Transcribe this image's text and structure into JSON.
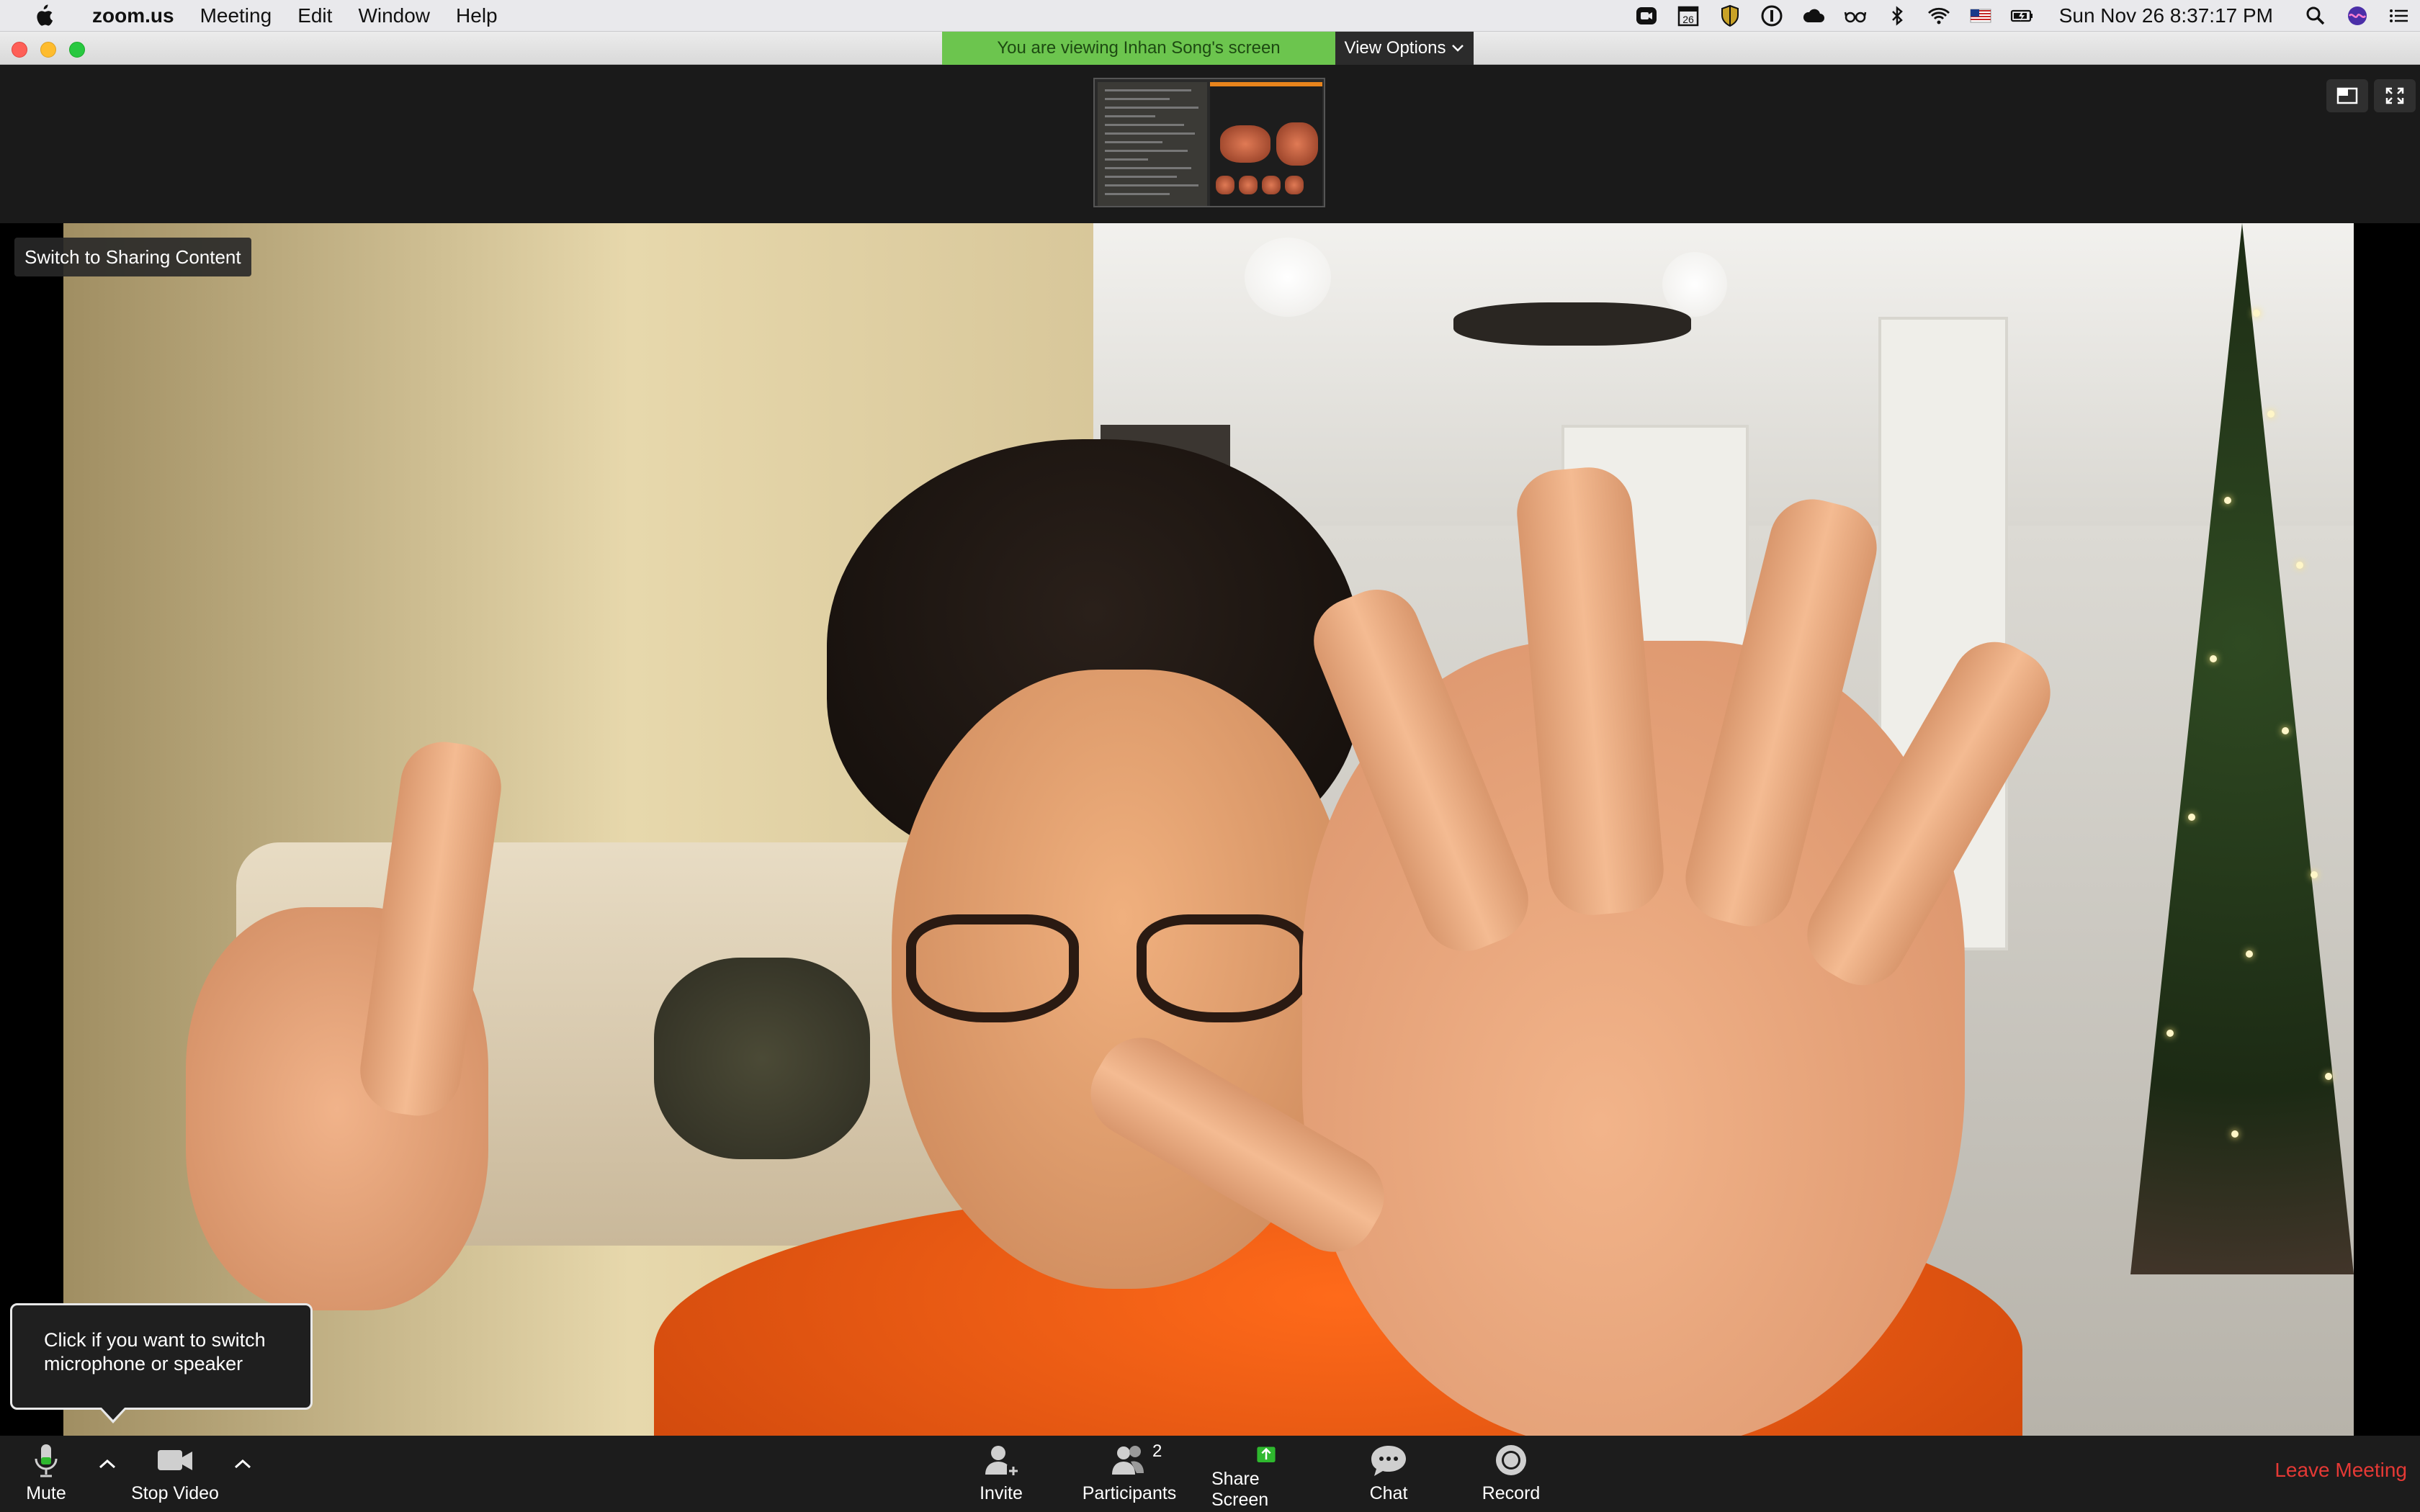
{
  "menubar": {
    "app_name": "zoom.us",
    "menus": [
      "Meeting",
      "Edit",
      "Window",
      "Help"
    ],
    "calendar_day": "26",
    "clock": "Sun Nov 26  8:37:17 PM"
  },
  "window": {
    "share_banner": "You are viewing Inhan Song's screen",
    "view_options": "View Options"
  },
  "video": {
    "switch_label": "Switch to Sharing Content"
  },
  "tooltip": {
    "text": "Click if you want to switch microphone or speaker"
  },
  "toolbar": {
    "mute": "Mute",
    "stop_video": "Stop Video",
    "invite": "Invite",
    "participants": "Participants",
    "participant_count": "2",
    "share_screen": "Share Screen",
    "chat": "Chat",
    "record": "Record",
    "leave": "Leave Meeting"
  },
  "colors": {
    "banner_green": "#6cc54e",
    "share_green": "#2eb82e",
    "leave_red": "#e53935",
    "toolbar_bg": "#1c1c1c"
  }
}
